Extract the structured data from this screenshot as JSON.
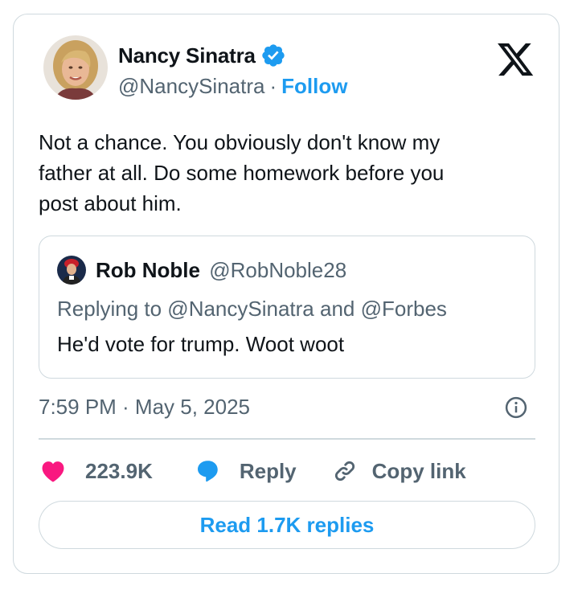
{
  "author": {
    "name": "Nancy Sinatra",
    "handle": "@NancySinatra",
    "separator": "·",
    "follow_label": "Follow",
    "verified": true,
    "avatar": "profile-photo"
  },
  "brand_icon": "x-logo-icon",
  "tweet": {
    "text": "Not a chance. You obviously don't know my father at all. Do some homework before you post about him.",
    "line1": "Not a chance. You obviously don't know my",
    "line2": "father at all. Do some homework before you",
    "line3": "post about him."
  },
  "quoted": {
    "name": "Rob Noble",
    "handle": "@RobNoble28",
    "replying_to": "Replying to @NancySinatra and @Forbes",
    "text": "He'd vote for trump. Woot woot"
  },
  "timestamp": "7:59 PM · May 5, 2025",
  "actions": {
    "like_count": "223.9K",
    "reply_label": "Reply",
    "copy_label": "Copy link"
  },
  "read_replies_label": "Read 1.7K replies",
  "colors": {
    "accent": "#1d9bf0",
    "like": "#f91880",
    "text": "#0f1419",
    "muted": "#536471",
    "border": "#cfd9de"
  }
}
